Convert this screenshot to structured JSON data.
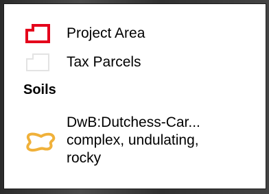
{
  "legend": {
    "items": [
      {
        "label": "Project Area",
        "icon": "red-outline-polygon-icon",
        "color": "#e4001b"
      },
      {
        "label": "Tax Parcels",
        "icon": "gray-outline-polygon-icon",
        "color": "#e3e3e3"
      }
    ],
    "section_heading": "Soils",
    "soil": {
      "icon": "orange-outline-blob-icon",
      "color": "#f0b13a",
      "lines": [
        "DwB:Dutchess-Car...",
        "complex, undulating,",
        "rocky"
      ]
    }
  }
}
